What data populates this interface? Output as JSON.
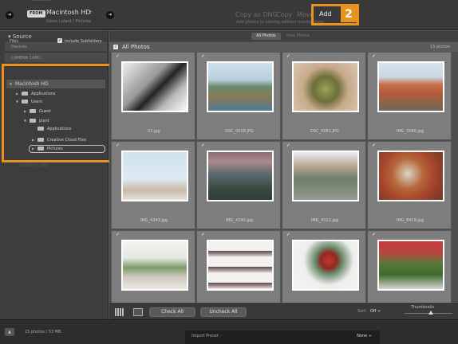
{
  "header": {
    "cut_text": "collection",
    "from_badge": "FROM",
    "source_name": "Macintosh HD",
    "source_dropdown": "÷",
    "source_path": "Users / plant / Pictures",
    "modes": {
      "copy_as_dng": "Copy as DNG",
      "copy": "Copy",
      "move": "Move",
      "add": "Add"
    },
    "mode_subtitle": "Add photos to catalog without moving them",
    "arrow_glyph": "➜"
  },
  "callouts": {
    "one": "1",
    "two": "2"
  },
  "colors": {
    "callout": "#e8931e"
  },
  "source_panel": {
    "header": "Source",
    "devices_label": "Devices",
    "camera_card_label": "CAMERA CARD",
    "files_label": "Files",
    "include_subfolders_label": "Include Subfolders",
    "include_subfolders_checked": true,
    "volume_label": "Macintosh HD",
    "tree": [
      {
        "label": "Applications"
      },
      {
        "label": "Users"
      },
      {
        "label": "Guest"
      },
      {
        "label": "plant"
      },
      {
        "label": "Applications"
      },
      {
        "label": "Creative Cloud Files"
      },
      {
        "label": "Pictures",
        "selected": true
      }
    ],
    "camera_card_bottom_label": "CAMERA CARD"
  },
  "main": {
    "tabs": [
      "All Photos",
      "New Photos"
    ],
    "all_photos_label": "All Photos",
    "photo_count": "15 photos",
    "photos": [
      {
        "name": "01.jpg",
        "icon": "photo-bw-camera"
      },
      {
        "name": "DSC_0018.JPG",
        "icon": "photo-coastal-cliffs"
      },
      {
        "name": "DSC_0081.JPG",
        "icon": "photo-hands-seeds"
      },
      {
        "name": "IMG_3560.jpg",
        "icon": "photo-red-rock-canyon"
      },
      {
        "name": "IMG_4343.jpg",
        "icon": "photo-jumping-legs"
      },
      {
        "name": "IMG_4240.jpg",
        "icon": "photo-mountain-valley"
      },
      {
        "name": "IMG_4312.jpg",
        "icon": "photo-victorian-houses"
      },
      {
        "name": "IMG_8419.jpg",
        "icon": "photo-retro-cameras"
      },
      {
        "name": "",
        "icon": "photo-kitchen-window"
      },
      {
        "name": "",
        "icon": "photo-shelf-cameras"
      },
      {
        "name": "",
        "icon": "photo-succulent-flowers"
      },
      {
        "name": "",
        "icon": "photo-sneakers-moss"
      }
    ]
  },
  "toolbar": {
    "check_all": "Check All",
    "uncheck_all": "Uncheck All",
    "sort_label": "Sort:",
    "sort_value": "Off ÷",
    "thumbnails_label": "Thumbnails"
  },
  "footer": {
    "info": "15 photos / 53 MB",
    "import_preset_label": "Import Preset :",
    "import_preset_value": "None ÷"
  }
}
